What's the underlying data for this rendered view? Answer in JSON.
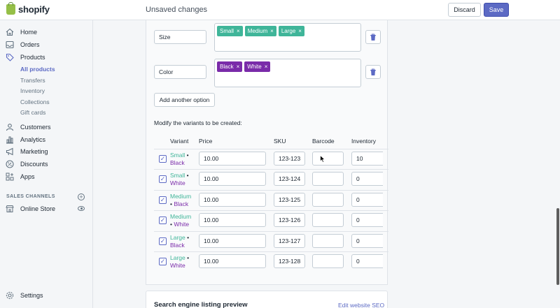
{
  "app": {
    "logo_text": "shopify"
  },
  "topbar": {
    "status": "Unsaved changes",
    "discard_label": "Discard",
    "save_label": "Save",
    "save_color": "#5c6ac4"
  },
  "sidebar": {
    "items": [
      {
        "label": "Home",
        "icon": "home-icon"
      },
      {
        "label": "Orders",
        "icon": "orders-icon"
      },
      {
        "label": "Products",
        "icon": "tag-icon"
      },
      {
        "label": "Customers",
        "icon": "person-icon"
      },
      {
        "label": "Analytics",
        "icon": "bar-chart-icon"
      },
      {
        "label": "Marketing",
        "icon": "megaphone-icon"
      },
      {
        "label": "Discounts",
        "icon": "discount-icon"
      },
      {
        "label": "Apps",
        "icon": "apps-icon"
      }
    ],
    "product_subitems": [
      "All products",
      "Transfers",
      "Inventory",
      "Collections",
      "Gift cards"
    ],
    "active_subitem": "All products",
    "channels_heading": "SALES CHANNELS",
    "online_store": "Online Store",
    "settings": "Settings"
  },
  "options": [
    {
      "name": "Size",
      "values": [
        "Small",
        "Medium",
        "Large"
      ],
      "tag_color": "#3fb599"
    },
    {
      "name": "Color",
      "values": [
        "Black",
        "White"
      ],
      "tag_color": "#7a2ba9"
    }
  ],
  "tag_remove_glyph": "×",
  "add_option_label": "Add another option",
  "variants_intro": "Modify the variants to be created:",
  "columns": {
    "variant": "Variant",
    "price": "Price",
    "sku": "SKU",
    "barcode": "Barcode",
    "inventory": "Inventory"
  },
  "variants": [
    {
      "size": "Small",
      "color": "Black",
      "checked": true,
      "price": "10.00",
      "sku": "123-123",
      "barcode": "",
      "inventory": "10"
    },
    {
      "size": "Small",
      "color": "White",
      "checked": true,
      "price": "10.00",
      "sku": "123-124",
      "barcode": "",
      "inventory": "0"
    },
    {
      "size": "Medium",
      "color": "Black",
      "checked": true,
      "price": "10.00",
      "sku": "123-125",
      "barcode": "",
      "inventory": "0"
    },
    {
      "size": "Medium",
      "color": "White",
      "checked": true,
      "price": "10.00",
      "sku": "123-126",
      "barcode": "",
      "inventory": "0"
    },
    {
      "size": "Large",
      "color": "Black",
      "checked": true,
      "price": "10.00",
      "sku": "123-127",
      "barcode": "",
      "inventory": "0"
    },
    {
      "size": "Large",
      "color": "White",
      "checked": true,
      "price": "10.00",
      "sku": "123-128",
      "barcode": "",
      "inventory": "0"
    }
  ],
  "variant_separator": "•",
  "seo": {
    "title": "Search engine listing preview",
    "link": "Edit website SEO"
  }
}
